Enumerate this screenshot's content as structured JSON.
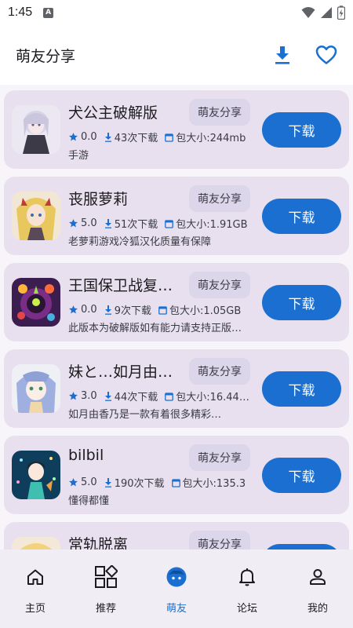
{
  "status_bar": {
    "time": "1:45",
    "indicator": "A"
  },
  "header": {
    "title": "萌友分享",
    "download_icon": "download-icon",
    "favorite_icon": "heart-icon"
  },
  "colors": {
    "accent": "#1b6fd0",
    "card_bg": "#e8e0ee",
    "tag_bg": "#dcd6ea",
    "star": "#1b6fd0"
  },
  "apps": [
    {
      "name": "犬公主破解版",
      "tag": "萌友分享",
      "rating": "0.0",
      "downloads": "43次下载",
      "size": "包大小:244mb",
      "desc": "手游",
      "button": "下载"
    },
    {
      "name": "丧服萝莉",
      "tag": "萌友分享",
      "rating": "5.0",
      "downloads": "51次下载",
      "size": "包大小:1.91GB",
      "desc": "老萝莉游戏冷狐汉化质量有保障",
      "button": "下载"
    },
    {
      "name": "王国保卫战复…",
      "tag": "萌友分享",
      "rating": "0.0",
      "downloads": "9次下载",
      "size": "包大小:1.05GB",
      "desc": "此版本为破解版如有能力请支持正版…",
      "button": "下载"
    },
    {
      "name": "妹と…如月由…",
      "tag": "萌友分享",
      "rating": "3.0",
      "downloads": "44次下载",
      "size": "包大小:16.44…",
      "desc": "如月由香乃是一款有着很多精彩…",
      "button": "下载"
    },
    {
      "name": "bilbil",
      "tag": "萌友分享",
      "rating": "5.0",
      "downloads": "190次下载",
      "size": "包大小:135.3",
      "desc": "懂得都懂",
      "button": "下载"
    },
    {
      "name": "常轨脱离",
      "tag": "萌友分享",
      "rating": "",
      "downloads": "",
      "size": "",
      "desc": "",
      "button": "下载"
    }
  ],
  "nav": [
    {
      "label": "主页",
      "icon": "home-icon"
    },
    {
      "label": "推荐",
      "icon": "grid-icon"
    },
    {
      "label": "萌友",
      "icon": "face-icon"
    },
    {
      "label": "论坛",
      "icon": "bell-icon"
    },
    {
      "label": "我的",
      "icon": "person-icon"
    }
  ],
  "nav_active_index": 2
}
